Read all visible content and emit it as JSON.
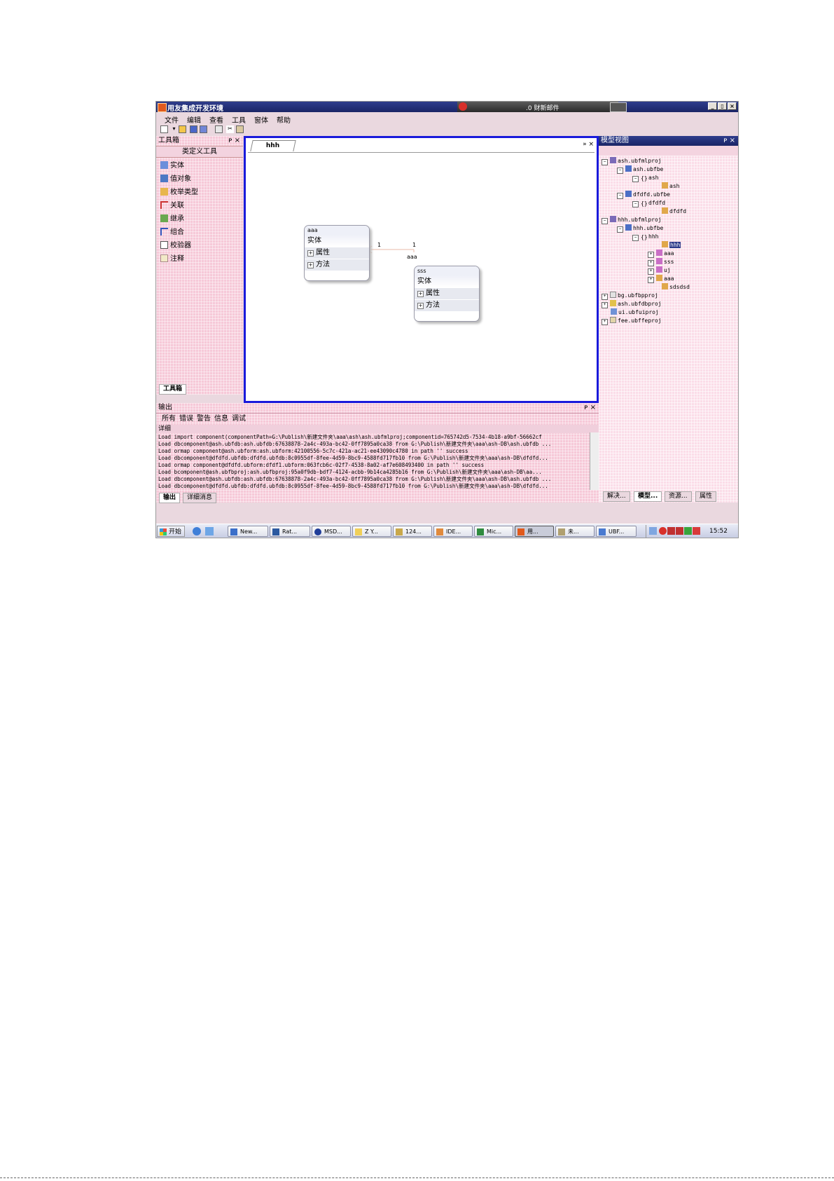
{
  "window": {
    "title": "用友集成开发环境",
    "notification": ".0 财新邮件",
    "buttons": {
      "minimize": "_",
      "restore": "▯",
      "close": "×"
    }
  },
  "menu": [
    "文件",
    "编辑",
    "查看",
    "工具",
    "窗体",
    "帮助"
  ],
  "toolbox": {
    "title": "工具箱",
    "pin": "ᴘ ×",
    "category": "类定义工具",
    "items": [
      "实体",
      "值对象",
      "枚举类型",
      "关联",
      "继承",
      "组合",
      "校验器",
      "注释"
    ],
    "bottom_tab": "工具箱"
  },
  "designer": {
    "tab": "hhh",
    "controls": "» ×",
    "entities": [
      {
        "name": "aaa",
        "stereotype": "实体",
        "sections": [
          "属性",
          "方法"
        ]
      },
      {
        "name": "sss",
        "stereotype": "实体",
        "sections": [
          "属性",
          "方法"
        ]
      }
    ],
    "association": {
      "source_mult": "1",
      "target_mult": "1",
      "role": "aaa"
    }
  },
  "output": {
    "title": "输出",
    "pin": "ᴘ ×",
    "filters": [
      "所有",
      "错误",
      "警告",
      "信息",
      "调试"
    ],
    "detail_header": "详细",
    "lines": [
      "Load import component(componentPath=G:\\Publish\\新建文件夹\\aaa\\ash\\ash.ubfmlproj;componentid=765742d5-7534-4b18-a9bf-56662cf",
      "Load dbcomponent@ash.ubfdb:ash.ubfdb:67638878-2a4c-493a-bc42-0ff7895a0ca38 from G:\\Publish\\新建文件夹\\aaa\\ash-DB\\ash.ubfdb ...",
      "Load ormap component@ash.ubform:ash.ubform:42100556-5c7c-421a-ac21-ee43090c4780 in path '' success",
      "Load dbcomponent@dfdfd.ubfdb:dfdfd.ubfdb:8c0955df-8fee-4d59-8bc9-4588fd717fb10 from G:\\Publish\\新建文件夹\\aaa\\ash-DB\\dfdfd...",
      "Load ormap component@dfdfd.ubform:dfdf1.ubform:063fcb6c-02f7-4538-8a02-af7e608493400 in path '' success",
      "Load bcomponent@ash.ubfbproj:ash.ubfbproj:95a0f9db-bdf7-4124-acbb-9b14ca4285b16 from G:\\Publish\\新建文件夹\\aaa\\ash-DB\\aa...",
      "Load dbcomponent@ash.ubfdb:ash.ubfdb:67638878-2a4c-493a-bc42-0ff7895a0ca38 from G:\\Publish\\新建文件夹\\aaa\\ash-DB\\ash.ubfdb ...",
      "Load dbcomponent@dfdfd.ubfdb:dfdfd.ubfdb:8c0955df-8fee-4d59-8bc9-4588fd717fb10 from G:\\Publish\\新建文件夹\\aaa\\ash-DB\\dfdfd..."
    ],
    "tabs": [
      "输出",
      "详细消息"
    ]
  },
  "modelview": {
    "title": "模型视图",
    "pin": "ᴘ ×",
    "tree": [
      {
        "label": "ash.ubfmlproj"
      },
      {
        "label": "ash.ubfbe"
      },
      {
        "label": "ash"
      },
      {
        "label": "ash"
      },
      {
        "label": "dfdfd.ubfbe"
      },
      {
        "label": "dfdfd"
      },
      {
        "label": "dfdfd"
      },
      {
        "label": "hhh.ubfmlproj"
      },
      {
        "label": "hhh.ubfbe"
      },
      {
        "label": "hhh"
      },
      {
        "label": "hhh"
      },
      {
        "label": "aaa"
      },
      {
        "label": "sss"
      },
      {
        "label": "uj"
      },
      {
        "label": "aaa"
      },
      {
        "label": "sdsdsd"
      },
      {
        "label": "bg.ubfbpproj"
      },
      {
        "label": "ash.ubfdbproj"
      },
      {
        "label": "ui.ubfuiproj"
      },
      {
        "label": "fee.ubffeproj"
      }
    ],
    "tabs": [
      "解决...",
      "模型...",
      "资源...",
      "属性"
    ]
  },
  "taskbar": {
    "start": "开始",
    "tasks": [
      "New...",
      "Rat...",
      "MSD...",
      "Z Y...",
      "124...",
      "IDE...",
      "Mic...",
      "用...",
      "未...",
      "UBF..."
    ],
    "clock": "15:52"
  },
  "colors": {
    "selection_frame": "#1a1adb",
    "panel_pink": "#f6c9d8",
    "titlebar": "#1b2566"
  }
}
